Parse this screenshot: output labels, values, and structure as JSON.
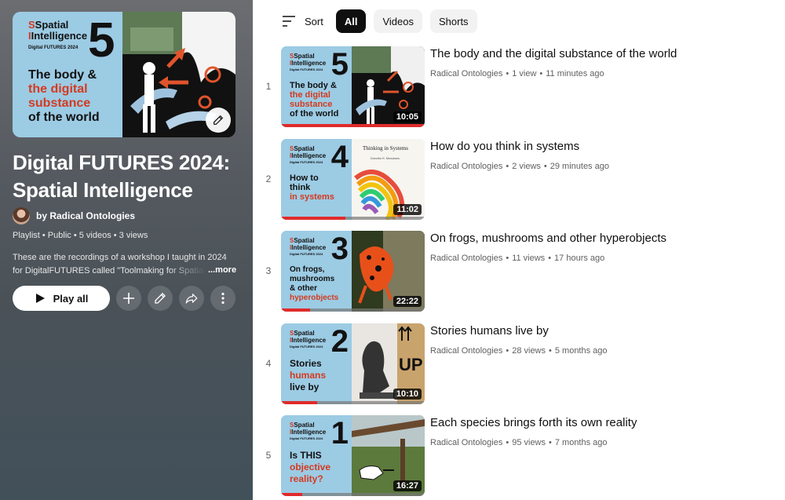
{
  "playlist": {
    "title": "Digital FUTURES 2024: Spatial Intelligence",
    "owner": "by Radical Ontologies",
    "meta": "Playlist • Public • 5 videos • 3 views",
    "description_line1": "These are the recordings of a workshop I taught in 2024",
    "description_line2": "for DigitalFUTURES called \"Toolmaking for Spatial",
    "more_label": "...more",
    "play_all_label": "Play all",
    "hero": {
      "brand_line1": "Spatial",
      "brand_line2": "Intelligence",
      "brand_sub": "Digital FUTURES 2024",
      "number": "5",
      "topic_line1": "The body &",
      "topic_line2": "the digital",
      "topic_line3": "substance",
      "topic_line4": "of the world"
    }
  },
  "filters": {
    "sort_label": "Sort",
    "chips": [
      "All",
      "Videos",
      "Shorts"
    ],
    "active": "All"
  },
  "videos": [
    {
      "index": "1",
      "title": "The body and the digital substance of the world",
      "channel": "Radical Ontologies",
      "views": "1 view",
      "age": "11 minutes ago",
      "duration": "10:05",
      "thumb_number": "5",
      "thumb_topic": [
        "The body &",
        "the digital",
        "substance",
        "of the world"
      ],
      "thumb_topic_red": [
        false,
        true,
        true,
        false
      ],
      "progress": 1.0
    },
    {
      "index": "2",
      "title": "How do you think in systems",
      "channel": "Radical Ontologies",
      "views": "2 views",
      "age": "29 minutes ago",
      "duration": "11:02",
      "thumb_number": "4",
      "thumb_topic": [
        "How to",
        "think",
        "in systems"
      ],
      "thumb_topic_red": [
        false,
        false,
        true
      ],
      "book_title": "Thinking in Systems",
      "book_author": "Donella H. Meadows",
      "progress": 0.45
    },
    {
      "index": "3",
      "title": "On frogs, mushrooms and other hyperobjects",
      "channel": "Radical Ontologies",
      "views": "11 views",
      "age": "17 hours ago",
      "duration": "22:22",
      "thumb_number": "3",
      "thumb_topic": [
        "On frogs,",
        "mushrooms",
        "& other",
        "hyperobjects"
      ],
      "thumb_topic_red": [
        false,
        false,
        false,
        true
      ],
      "progress": 0.2
    },
    {
      "index": "4",
      "title": "Stories humans live by",
      "channel": "Radical Ontologies",
      "views": "28 views",
      "age": "5 months ago",
      "duration": "10:10",
      "thumb_number": "2",
      "thumb_topic": [
        "Stories",
        "humans",
        "live by"
      ],
      "thumb_topic_red": [
        false,
        true,
        false
      ],
      "box_label": "UP",
      "progress": 0.25
    },
    {
      "index": "5",
      "title": "Each species brings forth its own reality",
      "channel": "Radical Ontologies",
      "views": "95 views",
      "age": "7 months ago",
      "duration": "16:27",
      "thumb_number": "1",
      "thumb_topic": [
        "Is THIS",
        "objective",
        "reality?"
      ],
      "thumb_topic_red": [
        false,
        true,
        true
      ],
      "progress": 0.15
    }
  ],
  "thumb_brand": {
    "line1": "Spatial",
    "line2": "Intelligence",
    "sub": "Digital FUTURES 2024"
  },
  "colors": {
    "accent_red": "#d43a1f",
    "thumb_blue": "#9ccbe4",
    "chip_active": "#0f0f0f",
    "chip_bg": "#f2f2f2",
    "progress_red": "#e02b2b"
  },
  "icons": {
    "sort": "sort-icon",
    "play": "play-icon",
    "add": "plus-icon",
    "edit": "pencil-icon",
    "share": "share-icon",
    "more": "more-vertical-icon"
  }
}
